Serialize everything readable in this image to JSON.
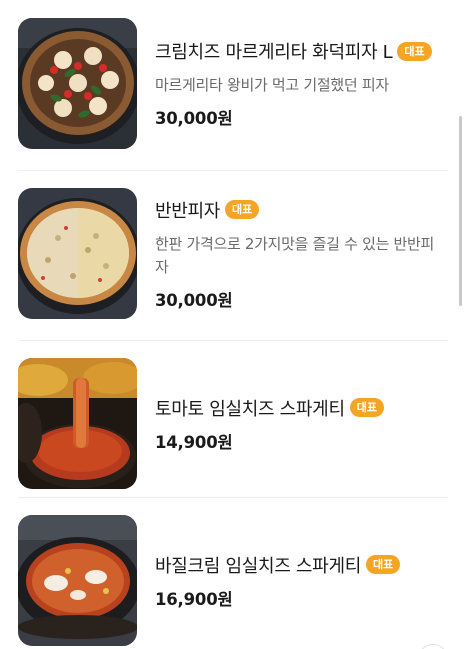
{
  "menu": {
    "items": [
      {
        "name": "크림치즈 마르게리타 화덕피자 L",
        "badge": "대표",
        "description": "마르게리타 왕비가 먹고 기절했던 피자",
        "price": "30,000원",
        "image": "cream-cheese-margherita-pizza-photo"
      },
      {
        "name": "반반피자",
        "badge": "대표",
        "description": "한판 가격으로 2가지맛을 즐길 수 있는 반반피자",
        "price": "30,000원",
        "image": "half-and-half-pizza-photo"
      },
      {
        "name": "토마토 임실치즈 스파게티",
        "badge": "대표",
        "description": "",
        "price": "14,900원",
        "image": "tomato-imsil-cheese-spaghetti-photo"
      },
      {
        "name": "바질크림 임실치즈 스파게티",
        "badge": "대표",
        "description": "",
        "price": "16,900원",
        "image": "basil-cream-imsil-cheese-spaghetti-photo"
      }
    ]
  },
  "colors": {
    "badge": "#f5a524",
    "text": "#1a1a1a",
    "description": "#6b6b6b",
    "divider": "#efefef"
  }
}
